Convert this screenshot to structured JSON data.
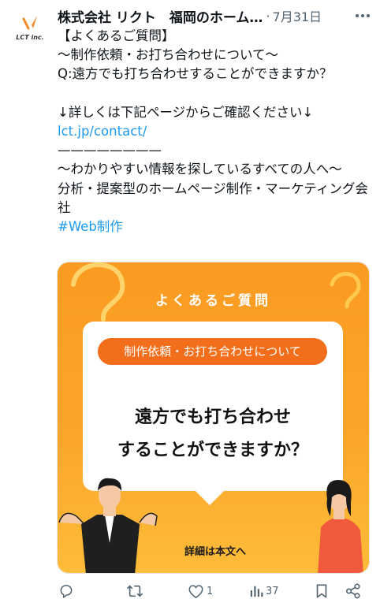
{
  "tweet": {
    "author": {
      "name": "株式会社 リクト　福岡のホーム…",
      "date": "7月31日",
      "avatar_text": "LCT inc.",
      "avatar_icon": "lct-logo-icon"
    },
    "body": {
      "lines": [
        "【よくあるご質問】",
        "〜制作依頼・お打ち合わせについて〜",
        "Q:遠方でも打ち合わせすることができますか？",
        "",
        "↓詳しくは下記ページからご確認ください↓",
        "lct.jp/contact/",
        "————————",
        "〜わかりやすい情報を探しているすべての人へ〜",
        "分析・提案型のホームページ制作・マーケティング会社",
        "#Web制作"
      ]
    },
    "media": {
      "faq_label": "よくあるご質問",
      "pill_text": "制作依頼・お打ち合わせについて",
      "question_line1": "遠方でも打ち合わせ",
      "question_line2": "することができますか？",
      "details_text": "詳細は本文へ"
    },
    "actions": {
      "reply_icon": "reply-icon",
      "retweet_icon": "retweet-icon",
      "like_icon": "heart-icon",
      "like_count": "1",
      "views_icon": "views-chart-icon",
      "views_count": "37",
      "bookmark_icon": "bookmark-icon",
      "share_icon": "share-icon"
    },
    "colors": {
      "link": "#1d9bf0",
      "secondary_text": "#536471",
      "accent_orange": "#f26e1b",
      "card_orange": "#fb9b21"
    }
  }
}
